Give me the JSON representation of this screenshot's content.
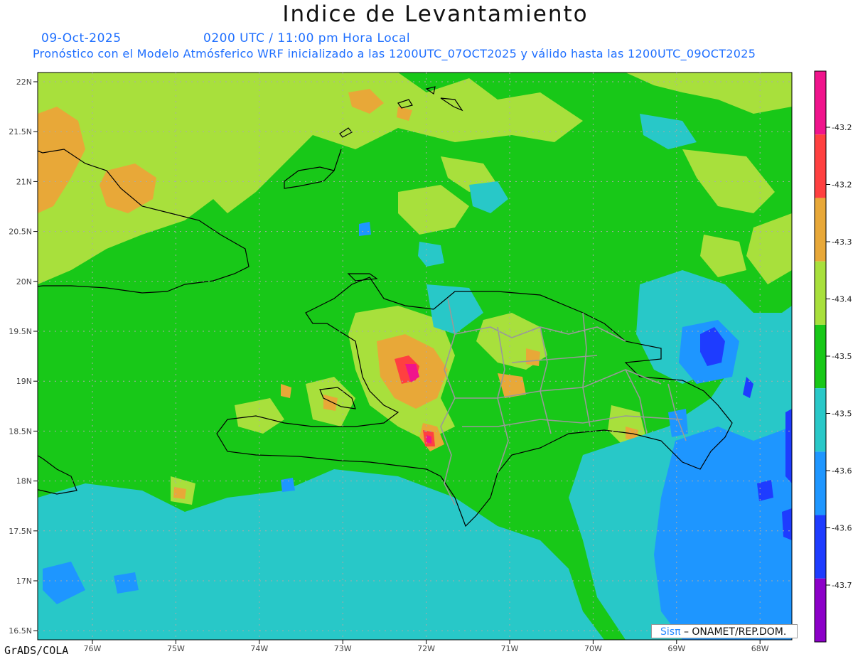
{
  "title": "Indice de Levantamiento",
  "date": "09-Oct-2025",
  "time": "0200 UTC / 11:00 pm Hora Local",
  "subtitle": "Pronóstico con el Modelo Atmósferico WRF inicializado a las 1200UTC_07OCT2025 y válido hasta las  1200UTC_09OCT2025",
  "lat_labels": [
    "22N",
    "21.5N",
    "21N",
    "20.5N",
    "20N",
    "19.5N",
    "19N",
    "18.5N",
    "18N",
    "17.5N",
    "17N",
    "16.5N"
  ],
  "lon_labels": [
    "76W",
    "75W",
    "74W",
    "73W",
    "72W",
    "71W",
    "70W",
    "69W",
    "68W"
  ],
  "colorbar": {
    "labels": [
      "-43.2",
      "-43.2",
      "-43.3",
      "-43.4",
      "-43.5",
      "-43.5",
      "-43.6",
      "-43.6",
      "-43.7"
    ],
    "colors": [
      "#f0148c",
      "#ff4040",
      "#e8a838",
      "#a8e03c",
      "#18c818",
      "#28c8c8",
      "#1e96ff",
      "#1e3cff",
      "#8c00c8"
    ]
  },
  "field_colors": {
    "ocean": "#18c818",
    "light_green": "#a8e03c",
    "orange": "#e8a838",
    "cyan": "#28c8c8",
    "blue": "#1e96ff",
    "dark_blue": "#1e3cff",
    "red": "#ff4040",
    "magenta": "#f0148c"
  },
  "credit": "GrADS/COLA",
  "logo": {
    "sis": "Sisπ",
    "org": "– ONAMET/REP.DOM."
  }
}
